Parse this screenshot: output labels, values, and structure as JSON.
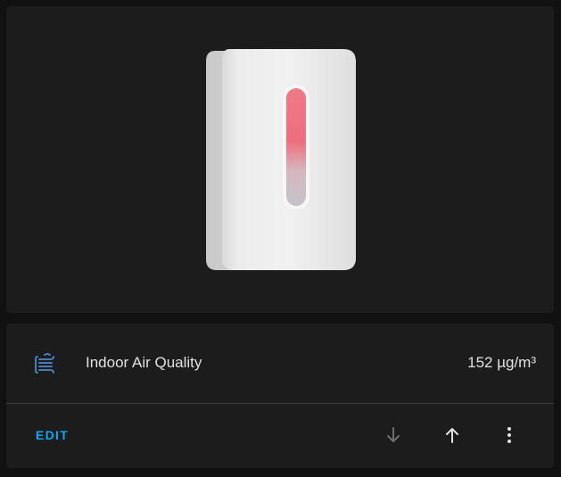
{
  "entity": {
    "name": "Indoor Air Quality",
    "state": "152 µg/m³",
    "icon": "air-filter-icon",
    "icon_color": "#4a7bb7"
  },
  "actions": {
    "edit_label": "EDIT",
    "move_down_icon": "arrow-down-icon",
    "move_up_icon": "arrow-up-icon",
    "more_icon": "dots-vertical-icon"
  },
  "colors": {
    "background": "#111111",
    "card": "#1c1c1c",
    "accent": "#03a9f4",
    "text": "#e1e1e1",
    "disabled": "#6f6f6f"
  }
}
